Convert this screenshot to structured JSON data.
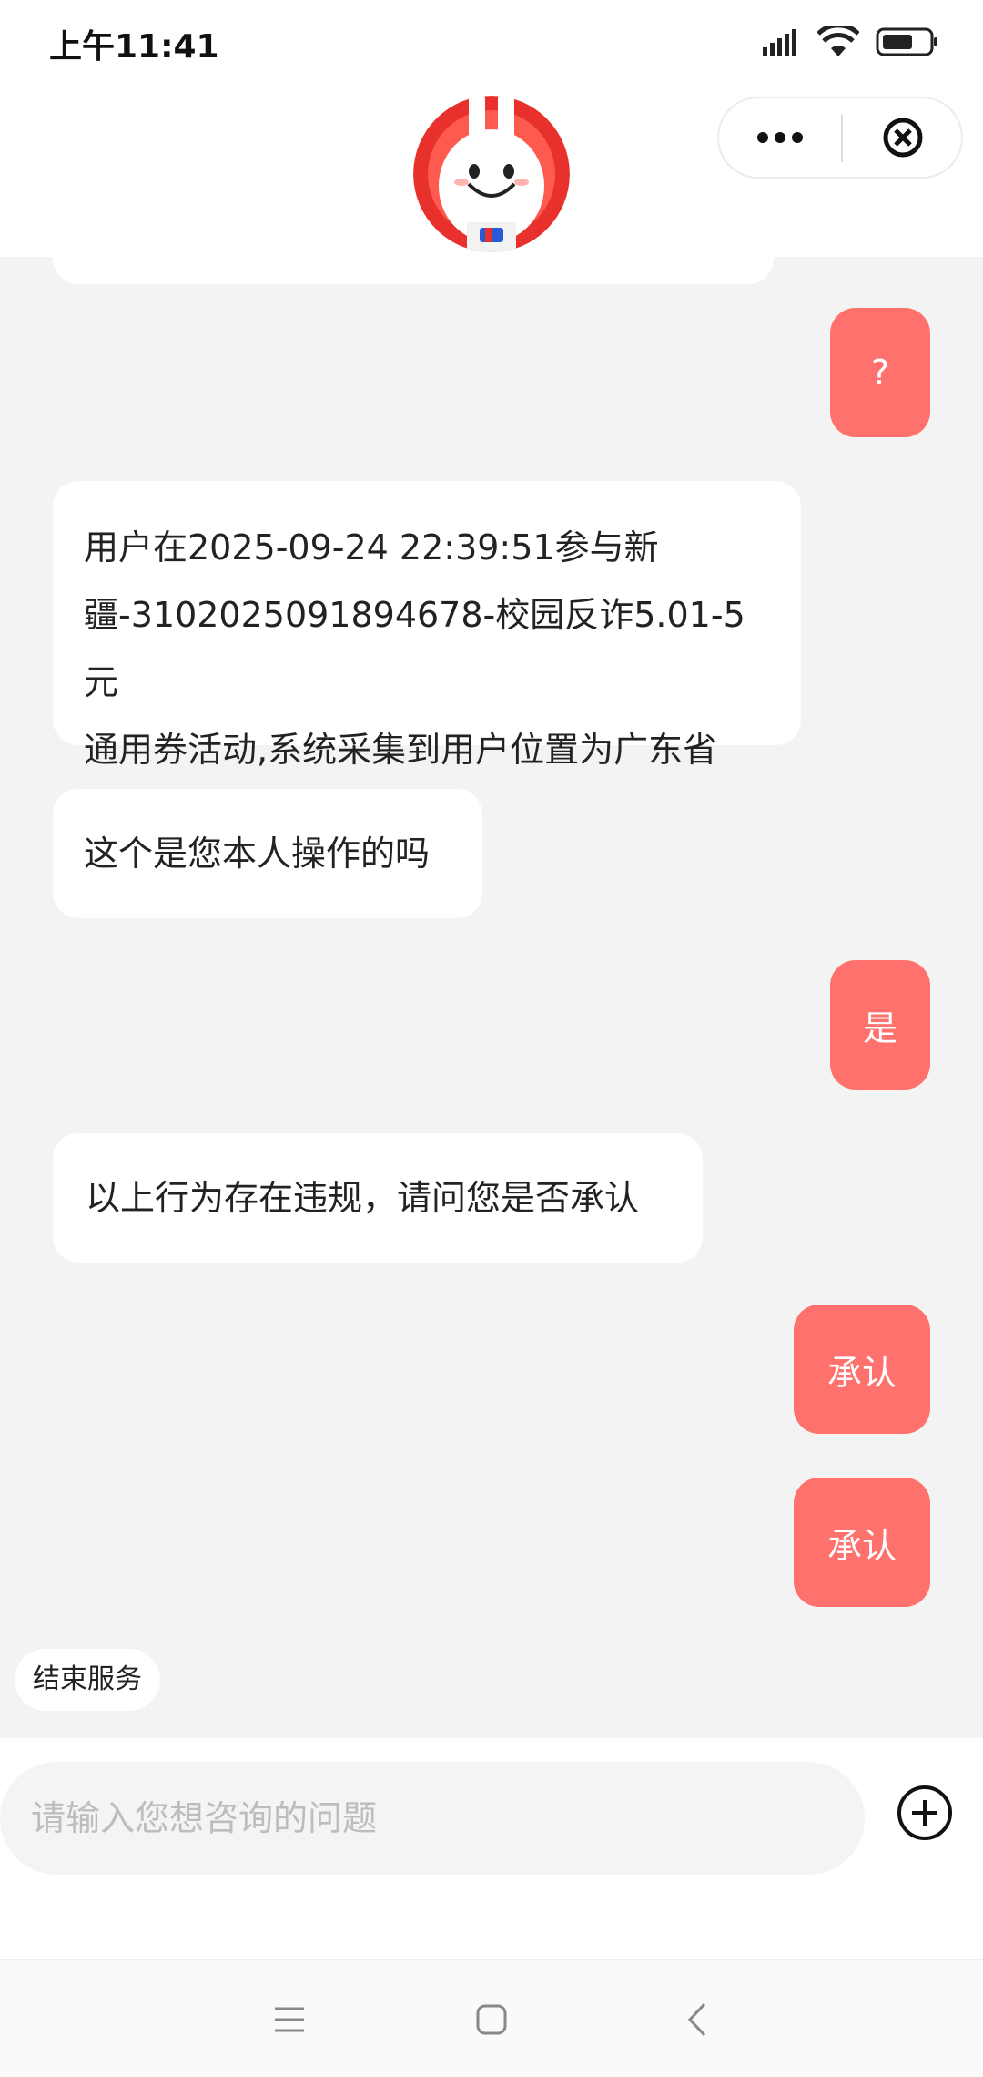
{
  "status_bar": {
    "time": "上午11:41",
    "icons": [
      "signal-icon",
      "wifi-icon",
      "battery-icon"
    ]
  },
  "header": {
    "avatar": "mascot-avatar",
    "menu_icon": "more-icon",
    "close_icon": "close-icon"
  },
  "messages": [
    {
      "side": "right",
      "text": "?"
    },
    {
      "side": "left",
      "lines": [
        "用户在2025-09-24 22:39:51参与新",
        "疆-3102025091894678-校园反诈5.01-5元",
        "通用券活动,系统采集到用户位置为广东省"
      ]
    },
    {
      "side": "left",
      "text": "这个是您本人操作的吗"
    },
    {
      "side": "right",
      "text": "是"
    },
    {
      "side": "left",
      "text": "以上行为存在违规，请问您是否承认"
    },
    {
      "side": "right",
      "text": "承认"
    },
    {
      "side": "right",
      "text": "承认"
    }
  ],
  "end_service_label": "结束服务",
  "input": {
    "placeholder": "请输入您想咨询的问题",
    "value": ""
  },
  "colors": {
    "user_bubble": "#ff716c",
    "bot_bubble": "#ffffff",
    "background": "#f3f3f3"
  },
  "nav": {
    "icons": [
      "menu-icon",
      "home-icon",
      "back-icon"
    ]
  }
}
